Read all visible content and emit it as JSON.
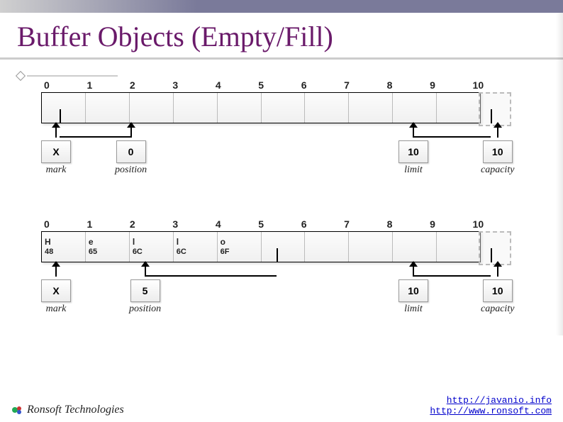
{
  "slide": {
    "title": "Buffer Objects (Empty/Fill)"
  },
  "diagram1": {
    "indices": [
      "0",
      "1",
      "2",
      "3",
      "4",
      "5",
      "6",
      "7",
      "8",
      "9",
      "10"
    ],
    "cells": [
      {
        "ch": "",
        "hx": ""
      },
      {
        "ch": "",
        "hx": ""
      },
      {
        "ch": "",
        "hx": ""
      },
      {
        "ch": "",
        "hx": ""
      },
      {
        "ch": "",
        "hx": ""
      },
      {
        "ch": "",
        "hx": ""
      },
      {
        "ch": "",
        "hx": ""
      },
      {
        "ch": "",
        "hx": ""
      },
      {
        "ch": "",
        "hx": ""
      },
      {
        "ch": "",
        "hx": ""
      }
    ],
    "pointers": {
      "mark": {
        "value": "X",
        "label": "mark"
      },
      "position": {
        "value": "0",
        "label": "position"
      },
      "limit": {
        "value": "10",
        "label": "limit"
      },
      "capacity": {
        "value": "10",
        "label": "capacity"
      }
    }
  },
  "diagram2": {
    "indices": [
      "0",
      "1",
      "2",
      "3",
      "4",
      "5",
      "6",
      "7",
      "8",
      "9",
      "10"
    ],
    "cells": [
      {
        "ch": "H",
        "hx": "48"
      },
      {
        "ch": "e",
        "hx": "65"
      },
      {
        "ch": "l",
        "hx": "6C"
      },
      {
        "ch": "l",
        "hx": "6C"
      },
      {
        "ch": "o",
        "hx": "6F"
      },
      {
        "ch": "",
        "hx": ""
      },
      {
        "ch": "",
        "hx": ""
      },
      {
        "ch": "",
        "hx": ""
      },
      {
        "ch": "",
        "hx": ""
      },
      {
        "ch": "",
        "hx": ""
      }
    ],
    "pointers": {
      "mark": {
        "value": "X",
        "label": "mark"
      },
      "position": {
        "value": "5",
        "label": "position"
      },
      "limit": {
        "value": "10",
        "label": "limit"
      },
      "capacity": {
        "value": "10",
        "label": "capacity"
      }
    }
  },
  "footer": {
    "company": "Ronsoft Technologies",
    "links": {
      "l1": "http://javanio.info",
      "l2": "http://www.ronsoft.com"
    }
  }
}
